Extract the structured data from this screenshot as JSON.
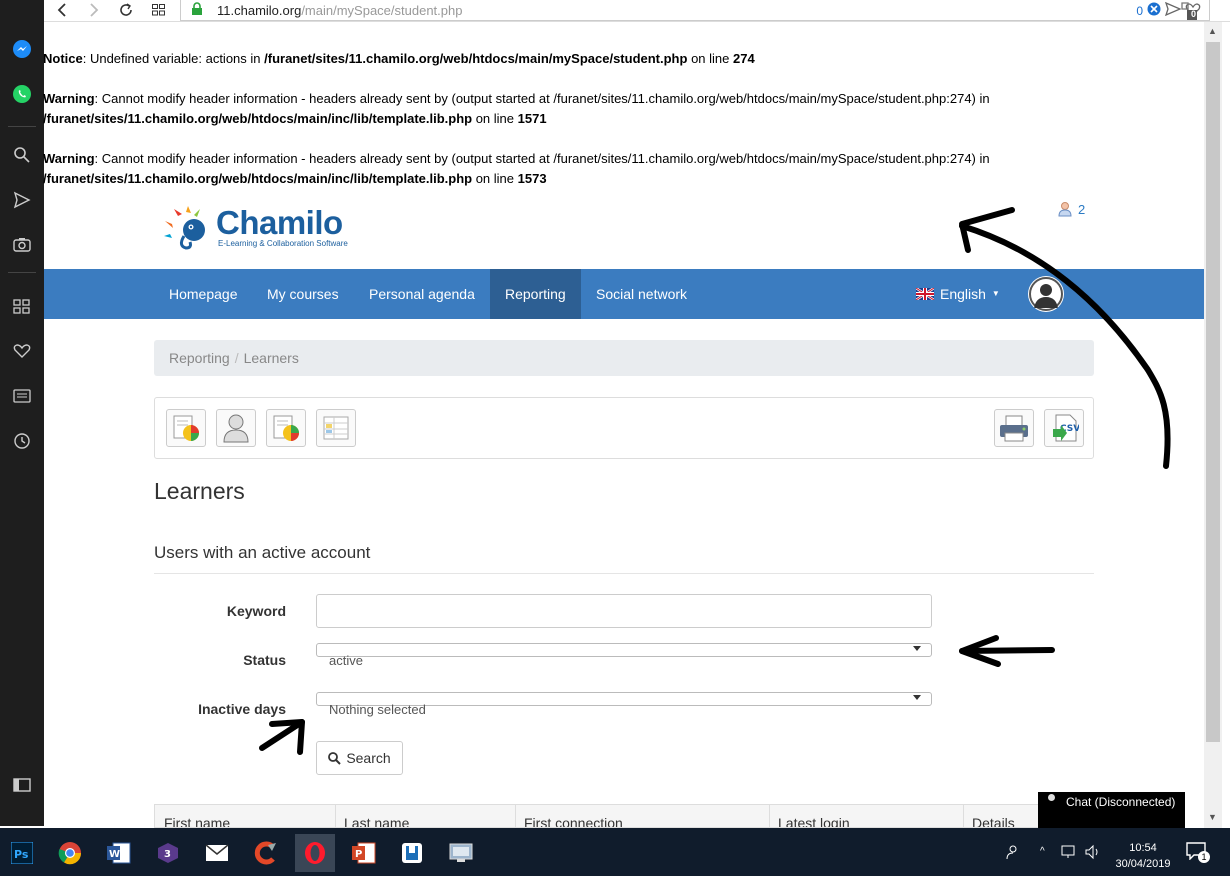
{
  "browser": {
    "url_domain": "11.chamilo.org",
    "url_path": "/main/mySpace/student.php",
    "badge_count": "0",
    "ext_badge": "0"
  },
  "errors": [
    {
      "type": "Notice",
      "msg": ": Undefined variable: actions in ",
      "file": "/furanet/sites/11.chamilo.org/web/htdocs/main/mySpace/student.php",
      "online": " on line ",
      "line": "274"
    },
    {
      "type": "Warning",
      "msg": ": Cannot modify header information - headers already sent by (output started at /furanet/sites/11.chamilo.org/web/htdocs/main/mySpace/student.php:274) in",
      "file": "/furanet/sites/11.chamilo.org/web/htdocs/main/inc/lib/template.lib.php",
      "online": " on line ",
      "line": "1571"
    },
    {
      "type": "Warning",
      "msg": ": Cannot modify header information - headers already sent by (output started at /furanet/sites/11.chamilo.org/web/htdocs/main/mySpace/student.php:274) in",
      "file": "/furanet/sites/11.chamilo.org/web/htdocs/main/inc/lib/template.lib.php",
      "online": " on line ",
      "line": "1573"
    }
  ],
  "header": {
    "logo_text": "Chamilo",
    "logo_sub": "E-Learning & Collaboration Software",
    "notification_count": "2"
  },
  "nav": {
    "items": [
      "Homepage",
      "My courses",
      "Personal agenda",
      "Reporting",
      "Social network"
    ],
    "active": "Reporting",
    "language": "English"
  },
  "breadcrumb": [
    "Reporting",
    "Learners"
  ],
  "page": {
    "title": "Learners",
    "section": "Users with an active account"
  },
  "form": {
    "keyword_label": "Keyword",
    "keyword_value": "",
    "status_label": "Status",
    "status_value": "active",
    "inactive_label": "Inactive days",
    "inactive_value": "Nothing selected",
    "search_label": "Search"
  },
  "table": {
    "columns": [
      "First name",
      "Last name",
      "First connection",
      "Latest login",
      "Details"
    ]
  },
  "chat": {
    "label": "Chat (Disconnected)"
  },
  "taskbar": {
    "time": "10:54",
    "date": "30/04/2019",
    "notif_count": "1"
  },
  "colors": {
    "navbar": "#3b7cc0",
    "navbar_active": "#2d5f93",
    "logo": "#1c5f9e"
  }
}
